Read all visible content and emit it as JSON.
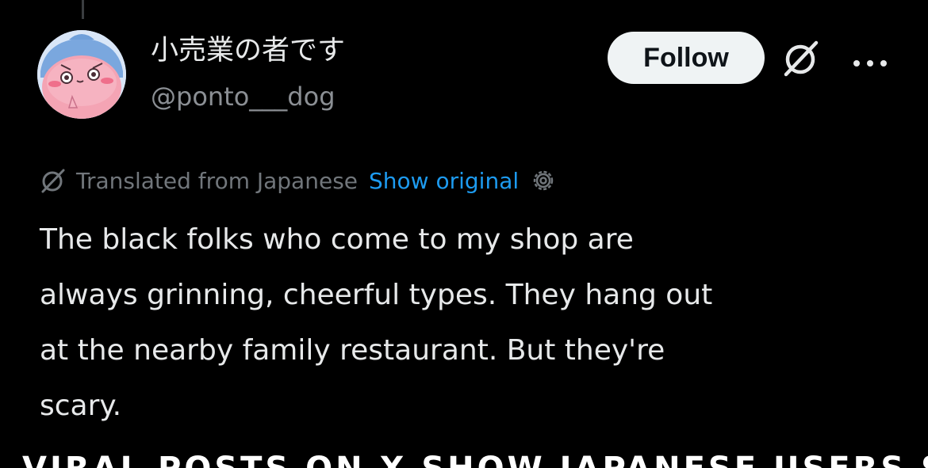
{
  "colors": {
    "background": "#000000",
    "primary_text": "#e7e9ea",
    "secondary_text": "#71767b",
    "link": "#1d9bf0",
    "follow_button_bg": "#eff3f4",
    "follow_button_text": "#0f1419"
  },
  "header": {
    "display_name": "小売業の者です",
    "handle": "@ponto___dog",
    "follow_label": "Follow",
    "grok_icon": "grok-icon",
    "more_icon": "more-horizontal-icon"
  },
  "translation": {
    "icon": "grok-translate-icon",
    "label": "Translated from Japanese",
    "show_original_label": "Show original",
    "settings_icon": "gear-icon"
  },
  "tweet": {
    "text": "The black folks who come to my shop are\nalways grinning, cheerful types. They hang out\nat the nearby family restaurant. But they're\nscary."
  },
  "caption": {
    "text": "VIRAL POSTS ON X SHOW JAPANESE USERS SPEAKY"
  }
}
